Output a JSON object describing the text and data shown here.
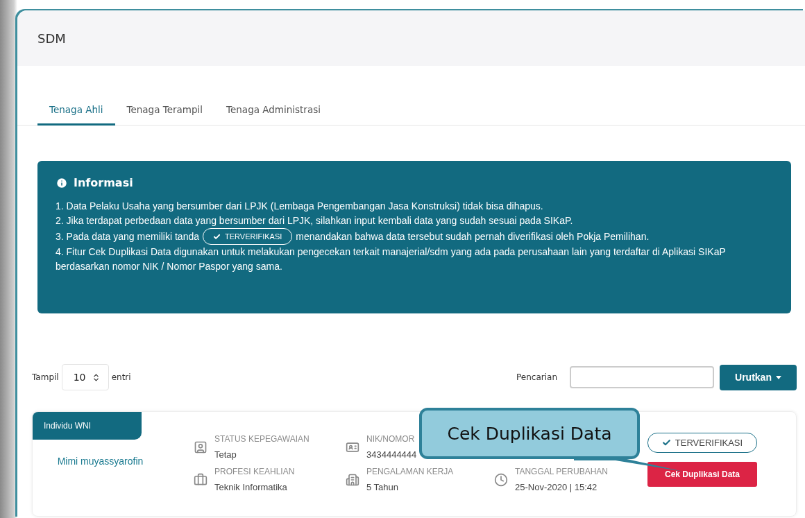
{
  "header": {
    "title": "SDM"
  },
  "tabs": [
    {
      "label": "Tenaga Ahli",
      "selected": true
    },
    {
      "label": "Tenaga Terampil",
      "selected": false
    },
    {
      "label": "Tenaga Administrasi",
      "selected": false
    }
  ],
  "info": {
    "title": "Informasi",
    "items": [
      {
        "text": "1. Data Pelaku Usaha yang bersumber dari LPJK (Lembaga Pengembangan Jasa Konstruksi) tidak bisa dihapus."
      },
      {
        "text": "2. Jika terdapat perbedaan data yang bersumber dari LPJK, silahkan input kembali data yang sudah sesuai pada SIKaP."
      },
      {
        "text": "3. Pada data yang memiliki tanda",
        "badge": "TERVERIFIKASI",
        "text_after": "menandakan bahwa data tersebut sudah pernah diverifikasi oleh Pokja Pemilihan."
      },
      {
        "text": "4. Fitur Cek Duplikasi Data digunakan untuk melakukan pengecekan terkait manajerial/sdm yang ada pada perusahaan lain yang terdaftar di Aplikasi SIKaP berdasarkan nomor NIK / Nomor Paspor yang sama."
      }
    ]
  },
  "toolbar": {
    "show_label": "Tampil",
    "page_size": "10",
    "entries_label": "entri",
    "search_label": "Pencarian",
    "sort_button": "Urutkan"
  },
  "card": {
    "type_label": "Individu WNI",
    "name": "Mimi muyassyarofin",
    "columns": [
      {
        "items": [
          {
            "kind": "badge",
            "label": "STATUS KEPEGAWAIAN",
            "value": "Tetap"
          },
          {
            "kind": "briefcase",
            "label": "PROFESI KEAHLIAN",
            "value": "Teknik Informatika"
          }
        ]
      },
      {
        "items": [
          {
            "kind": "idcard",
            "label": "NIK/NOMOR",
            "value": "3434444444"
          },
          {
            "kind": "building",
            "label": "PENGALAMAN KERJA",
            "value": "5 Tahun"
          }
        ]
      },
      {
        "items": [
          {
            "kind": "clock",
            "label": "TANGGAL PERUBAHAN",
            "value": "25-Nov-2020 | 15:42"
          }
        ]
      }
    ],
    "verified_badge": "TERVERIFIKASI",
    "duplicate_button": "Cek Duplikasi Data"
  },
  "callout": {
    "text": "Cek Duplikasi Data"
  }
}
